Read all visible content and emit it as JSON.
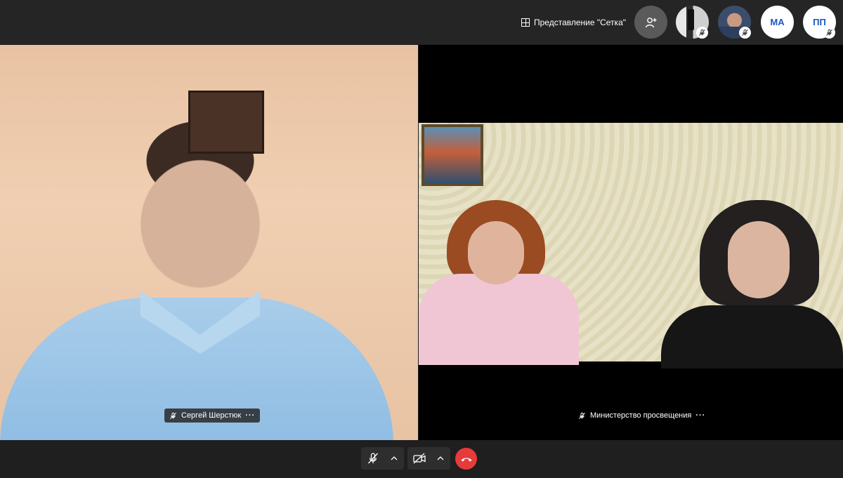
{
  "topbar": {
    "view_label": "Представление \"Сетка\"",
    "view_icon": "grid-icon",
    "add_participant_icon": "add-person-icon"
  },
  "participants": [
    {
      "kind": "photo",
      "muted": true
    },
    {
      "kind": "photo",
      "muted": true
    },
    {
      "kind": "initials",
      "initials": "МА",
      "muted": false
    },
    {
      "kind": "initials",
      "initials": "ПП",
      "muted": true
    }
  ],
  "tiles": {
    "left": {
      "name": "Сергей Шерстюк",
      "muted": true
    },
    "right": {
      "name": "Министерство просвещения",
      "muted": true
    }
  },
  "toolbar": {
    "mic_icon": "mic-off-icon",
    "camera_icon": "camera-off-icon",
    "hangup_icon": "hang-up-icon"
  },
  "colors": {
    "background": "#1f1f1f",
    "topbar": "#252525",
    "end_call": "#e63b3b",
    "initials_text": "#1a56c4"
  }
}
